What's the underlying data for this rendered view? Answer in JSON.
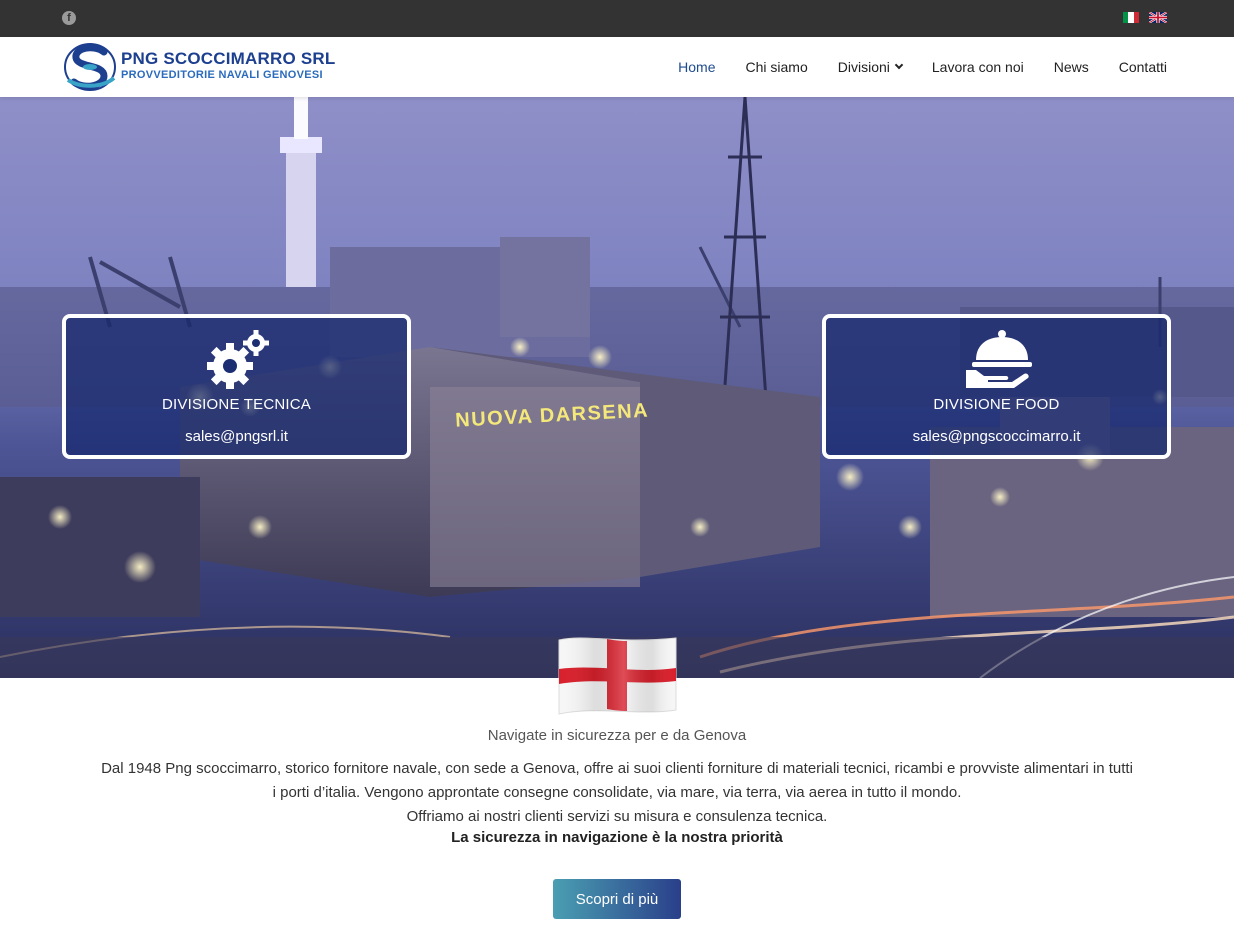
{
  "topbar": {
    "social": [
      {
        "icon": "facebook-icon",
        "glyph": "f"
      }
    ],
    "languages": [
      {
        "code": "it",
        "icon": "flag-italy-icon"
      },
      {
        "code": "en",
        "icon": "flag-uk-icon"
      }
    ]
  },
  "header": {
    "logo": {
      "line1": "PNG SCOCCIMARRO SRL",
      "line2": "PROVVEDITORIE NAVALI GENOVESI"
    },
    "nav": [
      {
        "label": "Home",
        "active": true
      },
      {
        "label": "Chi siamo"
      },
      {
        "label": "Divisioni",
        "has_dropdown": true
      },
      {
        "label": "Lavora con noi"
      },
      {
        "label": "News"
      },
      {
        "label": "Contatti"
      }
    ]
  },
  "hero": {
    "sign": "NUOVA DARSENA",
    "divisions": [
      {
        "title": "DIVISIONE TECNICA",
        "email": "sales@pngsrl.it",
        "icon": "gears-icon"
      },
      {
        "title": "DIVISIONE FOOD",
        "email": "sales@pngscoccimarro.it",
        "icon": "cloche-icon"
      }
    ]
  },
  "content": {
    "tagline": "Navigate  in sicurezza per e da Genova",
    "paragraph_line1": "Dal 1948 Png scoccimarro, storico fornitore navale, con sede a Genova, offre ai suoi clienti forniture di materiali tecnici, ricambi e provviste alimentari in tutti",
    "paragraph_line2": "i porti d’italia. Vengono approntate consegne consolidate, via mare, via terra, via aerea in tutto il mondo.",
    "paragraph_line3": "Offriamo ai nostri clienti servizi su misura e consulenza tecnica.",
    "strong": "La sicurezza in navigazione è la nostra priorità",
    "cta_label": "Scopri di più"
  },
  "colors": {
    "topbar": "#333333",
    "nav_active": "#1f4b8f",
    "box_bg": "#16286e",
    "cta_start": "#4a9fb2",
    "cta_end": "#2a3f8a"
  }
}
